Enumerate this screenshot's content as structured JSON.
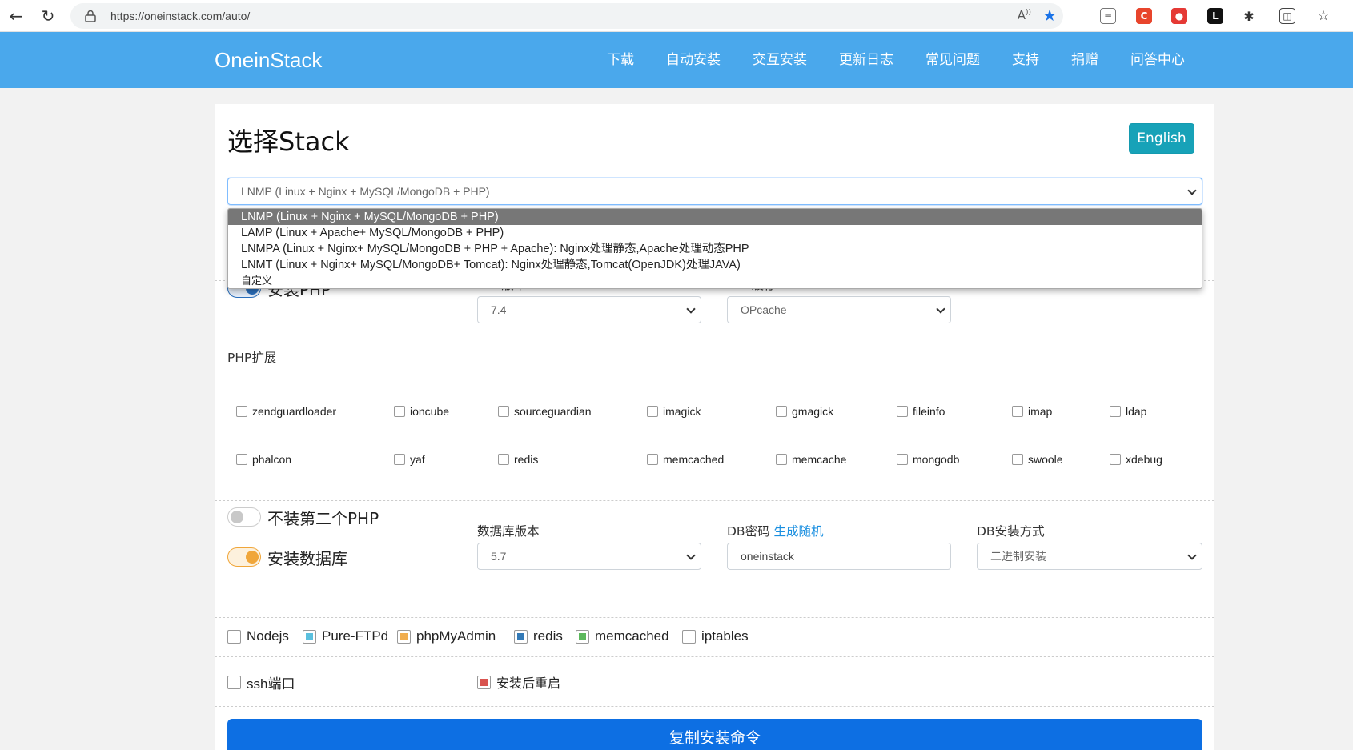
{
  "browser": {
    "url": "https://oneinstack.com/auto/"
  },
  "header": {
    "brand": "OneinStack",
    "menu": [
      "下载",
      "自动安装",
      "交互安装",
      "更新日志",
      "常见问题",
      "支持",
      "捐赠",
      "问答中心"
    ]
  },
  "page": {
    "title": "选择Stack",
    "english_button": "English",
    "stack_select_value": "LNMP (Linux + Nginx + MySQL/MongoDB + PHP)",
    "stack_options": [
      "LNMP (Linux + Nginx + MySQL/MongoDB + PHP)",
      "LAMP (Linux + Apache+ MySQL/MongoDB + PHP)",
      "LNMPA (Linux + Nginx+ MySQL/MongoDB + PHP + Apache): Nginx处理静态,Apache处理动态PHP",
      "LNMT (Linux + Nginx+ MySQL/MongoDB+ Tomcat): Nginx处理静态,Tomcat(OpenJDK)处理JAVA)",
      "自定义"
    ]
  },
  "php": {
    "install_label": "安装PHP",
    "install_on": true,
    "version_label": "PHP版本",
    "version_value": "7.4",
    "cache_label": "PHP缓存",
    "cache_value": "OPcache",
    "ext_label": "PHP扩展",
    "extensions": [
      [
        "zendguardloader",
        "ioncube",
        "sourceguardian",
        "imagick",
        "gmagick",
        "fileinfo",
        "imap",
        "ldap"
      ],
      [
        "phalcon",
        "yaf",
        "redis",
        "memcached",
        "memcache",
        "mongodb",
        "swoole",
        "xdebug"
      ]
    ]
  },
  "second_php": {
    "label": "不装第二个PHP",
    "on": false
  },
  "database": {
    "install_label": "安装数据库",
    "install_on": true,
    "version_label": "数据库版本",
    "version_value": "5.7",
    "password_label": "DB密码",
    "password_link": "生成随机",
    "password_value": "oneinstack",
    "method_label": "DB安装方式",
    "method_value": "二进制安装"
  },
  "extras": {
    "row1": [
      {
        "label": "Nodejs",
        "color": "#ffffff"
      },
      {
        "label": "Pure-FTPd",
        "color": "#5bc0de"
      },
      {
        "label": "phpMyAdmin",
        "color": "#f0ad4e"
      },
      {
        "label": "redis",
        "color": "#337ab7"
      },
      {
        "label": "memcached",
        "color": "#5cb85c"
      },
      {
        "label": "iptables",
        "color": "#ffffff"
      }
    ],
    "ssh_label": "ssh端口",
    "reboot_label": "安装后重启",
    "reboot_color": "#d9534f"
  },
  "copy_button": "复制安装命令",
  "colors": {
    "header_bg": "#4aa8ec",
    "english_bg": "#17a2b8",
    "copy_bg": "#0d6fe3",
    "toggle_php": "#2a6ebb",
    "toggle_db": "#f0a63a"
  }
}
